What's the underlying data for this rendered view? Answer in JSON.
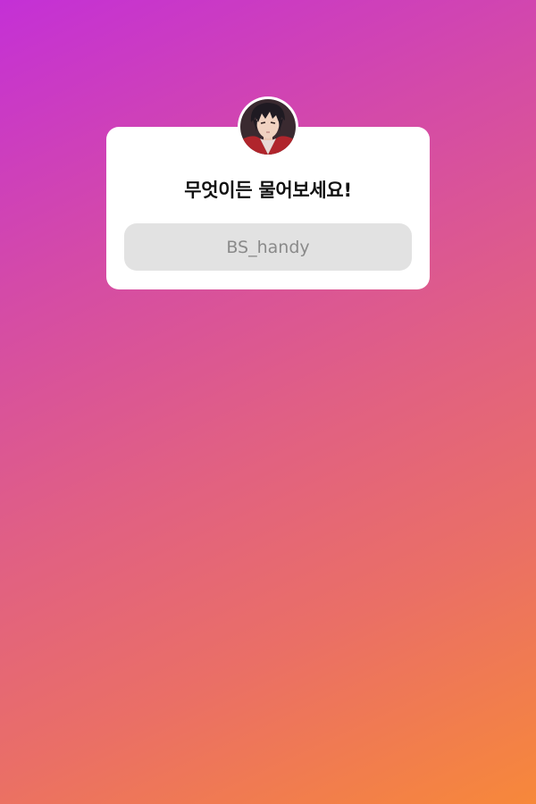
{
  "question_sticker": {
    "title": "무엇이든 물어보세요!",
    "answer_placeholder": "BS_handy"
  },
  "colors": {
    "gradient_start": "#c430d6",
    "gradient_mid": "#e05f85",
    "gradient_end": "#f7883a",
    "card_background": "#ffffff",
    "field_background": "#e2e2e2"
  },
  "icons": {
    "avatar": "profile-avatar"
  }
}
